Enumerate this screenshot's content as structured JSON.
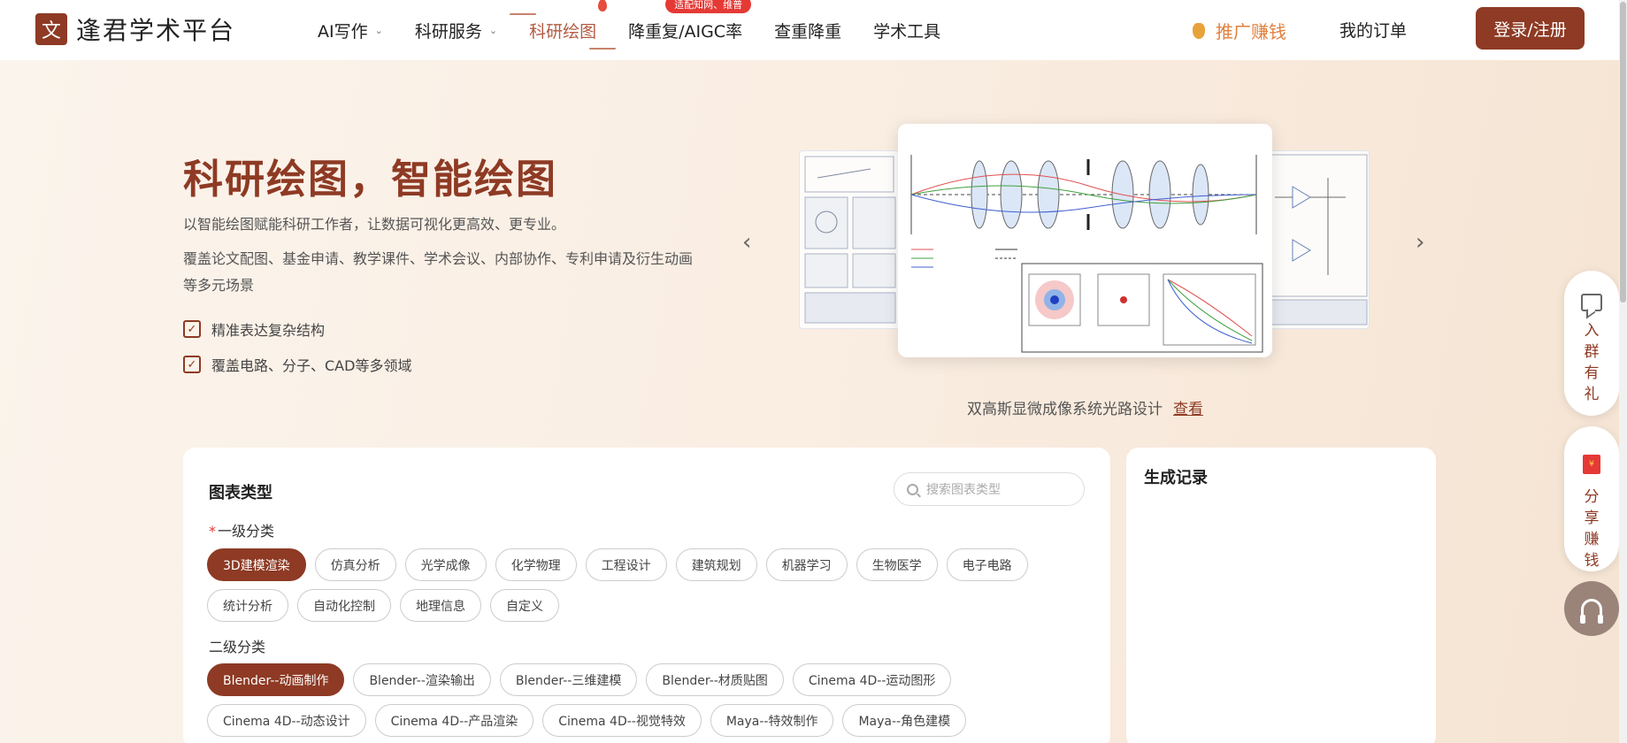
{
  "header": {
    "logo_mark": "文",
    "logo_text": "逢君学术平台",
    "nav": [
      {
        "label": "AI写作",
        "chevron": true
      },
      {
        "label": "科研服务",
        "chevron": true
      },
      {
        "label": "科研绘图",
        "active": true
      },
      {
        "label": "降重复/AIGC率",
        "badge": "适配知网、维普"
      },
      {
        "label": "查重降重"
      },
      {
        "label": "学术工具"
      }
    ],
    "promo": "推广赚钱",
    "orders": "我的订单",
    "login": "登录/注册"
  },
  "hero": {
    "title": "科研绘图，智能绘图",
    "subtitle": "以智能绘图赋能科研工作者，让数据可视化更高效、更专业。",
    "description": "覆盖论文配图、基金申请、教学课件、学术会议、内部协作、专利申请及衍生动画等多元场景",
    "features": [
      "精准表达复杂结构",
      "覆盖电路、分子、CAD等多领域"
    ]
  },
  "carousel": {
    "caption": "双高斯显微成像系统光路设计",
    "view_link": "查看",
    "prev": "‹",
    "next": "›"
  },
  "chart_types": {
    "title": "图表类型",
    "search_placeholder": "搜索图表类型",
    "level1_label": "一级分类",
    "level1": [
      "3D建模渲染",
      "仿真分析",
      "光学成像",
      "化学物理",
      "工程设计",
      "建筑规划",
      "机器学习",
      "生物医学",
      "电子电路",
      "统计分析",
      "自动化控制",
      "地理信息",
      "自定义"
    ],
    "level2_label": "二级分类",
    "level2": [
      "Blender--动画制作",
      "Blender--渲染输出",
      "Blender--三维建模",
      "Blender--材质贴图",
      "Cinema 4D--运动图形",
      "Cinema 4D--动态设计",
      "Cinema 4D--产品渲染",
      "Cinema 4D--视觉特效",
      "Maya--特效制作",
      "Maya--角色建模"
    ]
  },
  "records": {
    "title": "生成记录"
  },
  "side": {
    "group_text": "入群有礼",
    "share_text": "分享赚钱"
  }
}
